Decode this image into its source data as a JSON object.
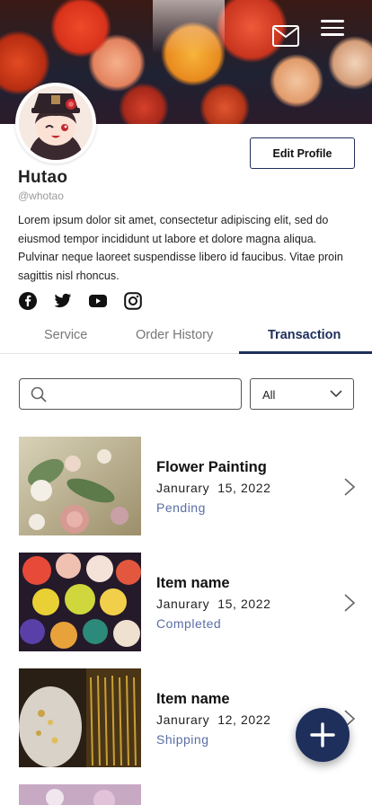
{
  "profile": {
    "name": "Hutao",
    "handle": "@whotao",
    "bio": "Lorem ipsum dolor sit amet, consectetur adipiscing elit, sed do eiusmod tempor incididunt ut labore et dolore magna aliqua. Pulvinar neque laoreet suspendisse libero id faucibus. Vitae proin sagittis nisl rhoncus.",
    "edit_button": "Edit Profile"
  },
  "header": {
    "icons": [
      "mail-icon",
      "menu-icon"
    ]
  },
  "social": [
    "facebook-icon",
    "twitter-icon",
    "youtube-icon",
    "instagram-icon"
  ],
  "tabs": {
    "service": "Service",
    "order_history": "Order History",
    "transaction": "Transaction",
    "active": "Transaction"
  },
  "filter": {
    "search_placeholder": "",
    "select_value": "All"
  },
  "transactions": [
    {
      "title": "Flower Painting",
      "date": "Janurary  15, 2022",
      "status": "Pending"
    },
    {
      "title": "Item name",
      "date": "Janurary  15, 2022",
      "status": "Completed"
    },
    {
      "title": "Item name",
      "date": "Janurary  12, 2022",
      "status": "Shipping"
    }
  ],
  "colors": {
    "primary": "#1f2f5c",
    "status": "#5a6ea5"
  },
  "fab_icon": "plus-icon"
}
